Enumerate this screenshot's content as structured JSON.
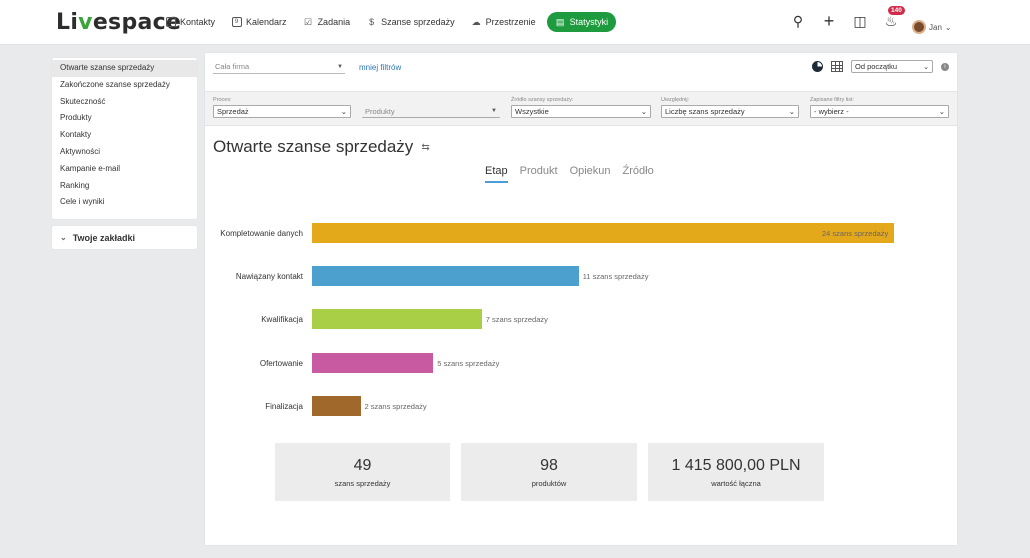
{
  "app": {
    "logo": {
      "prefix": "Li",
      "accent": "v",
      "suffix": "espace"
    }
  },
  "nav": [
    {
      "label": "Kontakty",
      "icon": "contacts-icon"
    },
    {
      "label": "Kalendarz",
      "icon": "calendar-icon"
    },
    {
      "label": "Zadania",
      "icon": "tasks-icon"
    },
    {
      "label": "Szanse sprzedaży",
      "icon": "dollar-icon"
    },
    {
      "label": "Przestrzenie",
      "icon": "cloud-icon"
    },
    {
      "label": "Statystyki",
      "icon": "stats-icon",
      "active": true
    }
  ],
  "header_tools": {
    "notifications_count": "140",
    "user_name": "Jan"
  },
  "sidebar": {
    "items": [
      {
        "label": "Otwarte szanse sprzedaży",
        "active": true
      },
      {
        "label": "Zakończone szanse sprzedaży"
      },
      {
        "label": "Skuteczność"
      },
      {
        "label": "Produkty"
      },
      {
        "label": "Kontakty"
      },
      {
        "label": "Aktywności"
      },
      {
        "label": "Kampanie e-mail"
      },
      {
        "label": "Ranking"
      },
      {
        "label": "Cele i wyniki"
      }
    ],
    "bookmarks_label": "Twoje zakładki"
  },
  "filters": {
    "company_placeholder": "Cała firma",
    "less_filters": "mniej filtrów",
    "period": "Od początku",
    "process": {
      "label": "Proces:",
      "value": "Sprzedaż"
    },
    "products": {
      "value": "Produkty"
    },
    "source": {
      "label": "Źródło szansy sprzedaży:",
      "value": "Wszystkie"
    },
    "include": {
      "label": "Uwzględnij:",
      "value": "Liczbę szans sprzedaży"
    },
    "saved": {
      "label": "Zapisane filtry list:",
      "value": "- wybierz -"
    }
  },
  "main": {
    "title": "Otwarte szanse sprzedaży",
    "tabs": [
      {
        "label": "Etap",
        "active": true
      },
      {
        "label": "Produkt"
      },
      {
        "label": "Opiekun"
      },
      {
        "label": "Źródło"
      }
    ]
  },
  "chart_data": {
    "type": "bar",
    "orientation": "horizontal",
    "categories": [
      "Kompletowanie danych",
      "Nawiązany kontakt",
      "Kwalifikacja",
      "Ofertowanie",
      "Finalizacja"
    ],
    "values": [
      24,
      11,
      7,
      5,
      2
    ],
    "value_labels": [
      "24 szans sprzedaży",
      "11 szans sprzedaży",
      "7 szans sprzedaży",
      "5 szans sprzedaży",
      "2 szans sprzedaży"
    ],
    "colors": [
      "#e4a91b",
      "#4ba0ce",
      "#a8cf45",
      "#c75aa0",
      "#a0692b"
    ],
    "xlim": [
      0,
      24
    ]
  },
  "stats": [
    {
      "value": "49",
      "caption": "szans sprzedaży"
    },
    {
      "value": "98",
      "caption": "produktów"
    },
    {
      "value": "1 415 800,00 PLN",
      "caption": "wartość łączna"
    }
  ]
}
